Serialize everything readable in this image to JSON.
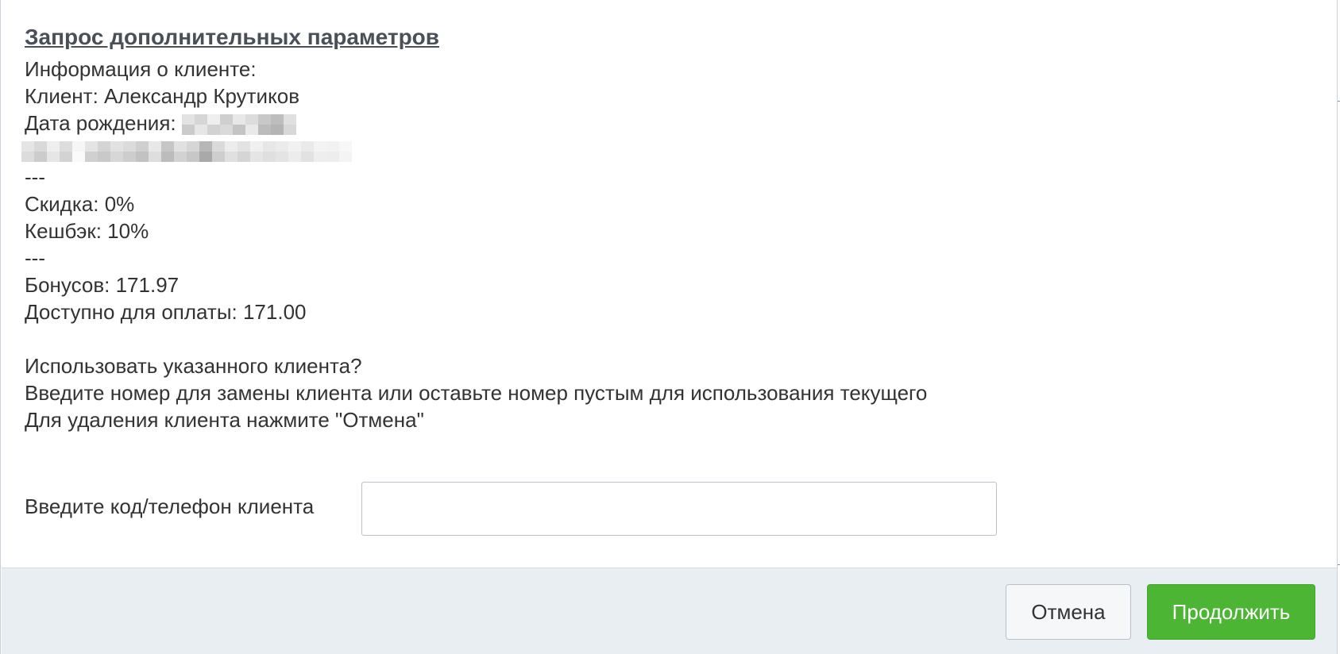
{
  "dialog": {
    "title": "Запрос дополнительных параметров",
    "info_heading": "Информация о клиенте:",
    "client_line": "Клиент: Александр Крутиков",
    "birthdate_label": "Дата рождения:",
    "separator": "---",
    "discount_line": "Скидка: 0%",
    "cashback_line": "Кешбэк: 10%",
    "bonuses_line": "Бонусов: 171.97",
    "available_line": "Доступно для оплаты: 171.00",
    "question_line": "Использовать указанного клиента?",
    "instruction_line": "Введите номер для замены клиента или оставьте номер пустым для использования текущего",
    "cancel_hint_line": "Для удаления клиента нажмите \"Отмена\""
  },
  "form": {
    "client_code_label": "Введите код/телефон клиента",
    "client_code_value": "",
    "client_code_placeholder": ""
  },
  "footer": {
    "cancel_label": "Отмена",
    "continue_label": "Продолжить"
  },
  "colors": {
    "primary_button": "#4cb634",
    "footer_background": "#e9eef3",
    "title_text": "#4a5058"
  },
  "redacted": {
    "birthdate": "pixelated",
    "extra_info_line": "pixelated"
  }
}
